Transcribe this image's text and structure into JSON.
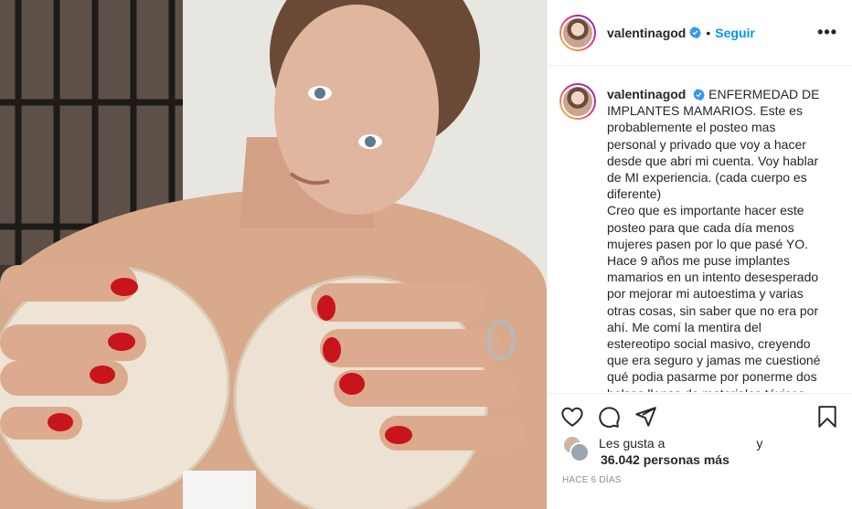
{
  "header": {
    "username": "valentinagod",
    "dot": "•",
    "follow_label": "Seguir",
    "more_label": "•••"
  },
  "caption": {
    "username": "valentinagod",
    "paragraph1": "ENFERMEDAD DE IMPLANTES MAMARIOS. Este es probablemente el posteo mas personal y privado que voy a hacer desde que abri mi cuenta. Voy hablar de MI experiencia. (cada cuerpo es diferente)",
    "paragraph2": "Creo que es importante hacer este posteo para que cada día menos mujeres pasen por lo que pasé YO. Hace 9 años me puse implantes mamarios en un intento desesperado por mejorar mi autoestima y varias otras cosas, sin saber que no era por ahí. Me comí la mentira del estereotipo social masivo, creyendo que era seguro y jamas me cuestioné qué podia pasarme por ponerme dos bolsas llenas de materiales tóxicos"
  },
  "likes": {
    "prefix": "Les gusta a",
    "conjunction": "y",
    "count_text": "36.042 personas más"
  },
  "timestamp": "HACE 6 DÍAS",
  "icons": {
    "like": "heart-icon",
    "comment": "comment-icon",
    "share": "share-icon",
    "save": "bookmark-icon",
    "verified": "verified-badge-icon"
  },
  "colors": {
    "accent": "#0095f6",
    "verified": "#3897f0",
    "nail_polish": "#c8141c"
  }
}
